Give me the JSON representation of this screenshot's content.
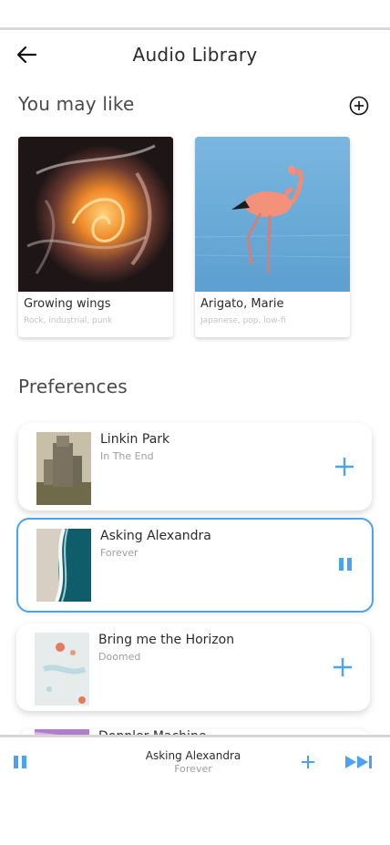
{
  "header": {
    "title": "Audio Library",
    "back_icon": "arrow-left-icon"
  },
  "recommendations": {
    "title": "You may like",
    "add_icon": "plus-circle-icon",
    "items": [
      {
        "title": "Growing wings",
        "genres": "Rock, industrial, punk",
        "art": "abstract-fire-swirl"
      },
      {
        "title": "Arigato, Marie",
        "genres": "Japanese, pop, low-fi",
        "art": "flamingo-in-water"
      }
    ]
  },
  "preferences": {
    "title": "Preferences",
    "items": [
      {
        "artist": "Linkin Park",
        "song": "In The End",
        "action_icon": "plus-icon",
        "state": "idle"
      },
      {
        "artist": "Asking Alexandra",
        "song": "Forever",
        "action_icon": "pause-icon",
        "state": "playing"
      },
      {
        "artist": "Bring me the Horizon",
        "song": "Doomed",
        "action_icon": "plus-icon",
        "state": "idle"
      },
      {
        "artist": "Doppler Machine"
      }
    ]
  },
  "player": {
    "title": "Asking Alexandra",
    "subtitle": "Forever",
    "pause_icon": "pause-icon",
    "add_icon": "plus-icon",
    "next_icon": "skip-next-icon"
  },
  "colors": {
    "accent": "#4aa3ee",
    "text": "#2b2b2b",
    "muted": "#9e9e9e",
    "faint": "#c4c4c4"
  }
}
